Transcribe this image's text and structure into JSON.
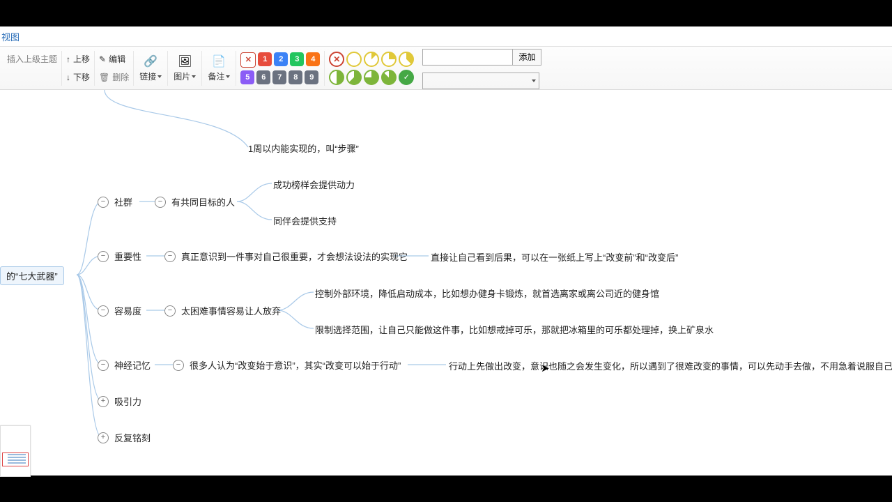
{
  "tab": "视图",
  "toolbar": {
    "insert_parent": "插入上级主题",
    "up": "上移",
    "down": "下移",
    "edit": "编辑",
    "delete": "删除",
    "link": "链接",
    "image": "图片",
    "note": "备注",
    "add": "添加"
  },
  "priority": {
    "numbers": [
      "1",
      "2",
      "3",
      "4",
      "5",
      "6",
      "7",
      "8",
      "9"
    ]
  },
  "mindmap": {
    "root": "的“七大武器”",
    "step_leaf": "1周以内能实现的，叫“步骤”",
    "n1": {
      "label": "社群",
      "child": "有共同目标的人",
      "leaves": [
        "成功榜样会提供动力",
        "同伴会提供支持"
      ]
    },
    "n2": {
      "label": "重要性",
      "child": "真正意识到一件事对自己很重要，才会想法设法的实现它",
      "leaf": "直接让自己看到后果，可以在一张纸上写上“改变前”和“改变后”"
    },
    "n3": {
      "label": "容易度",
      "child": "太困难事情容易让人放弃",
      "leaves": [
        "控制外部环境，降低启动成本，比如想办健身卡锻炼，就首选离家或离公司近的健身馆",
        "限制选择范围，让自己只能做这件事，比如想戒掉可乐，那就把冰箱里的可乐都处理掉，换上矿泉水"
      ]
    },
    "n4": {
      "label": "神经记忆",
      "child": "很多人认为“改变始于意识”，其实“改变可以始于行动”",
      "leaf": "行动上先做出改变，意识也随之会发生变化，所以遇到了很难改变的事情，可以先动手去做，不用急着说服自己"
    },
    "n5": {
      "label": "吸引力"
    },
    "n6": {
      "label": "反复铭刻"
    }
  }
}
